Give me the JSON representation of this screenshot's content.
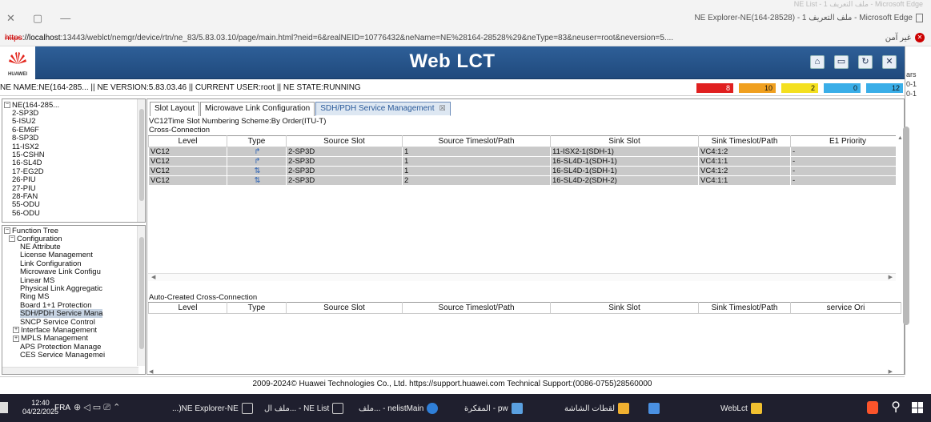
{
  "browser": {
    "window_title": "NE Explorer-NE(164-28528) - 1 ملف التعريف - Microsoft Edge",
    "faded_title": "NE List - 1 ملف التعريف - Microsoft Edge",
    "url_protocol": "https",
    "url_host": "://localhost",
    "url_rest": ":13443/weblct/nemgr/device/rtn/ne_83/5.83.03.10/page/main.html?neid=6&realNEID=10776432&neName=NE%28164-28528%29&neType=83&neuser=root&neversion=5....",
    "not_secure": "غير آمن",
    "minimize": "—",
    "restore": "▢",
    "close": "✕"
  },
  "app": {
    "title": "Web LCT",
    "logo_text": "HUAWEI",
    "header_icons": [
      "home-icon",
      "monitor-icon",
      "refresh-icon",
      "close-icon"
    ],
    "ne_info": "NE NAME:NE(164-285... || NE VERSION:5.83.03.46 || CURRENT USER:root || NE STATE:RUNNING",
    "alarms": [
      {
        "value": "8",
        "color": "#e02020"
      },
      {
        "value": "10",
        "color": "#f0a020"
      },
      {
        "value": "2",
        "color": "#f4e020"
      },
      {
        "value": "0",
        "color": "#3aaee8"
      },
      {
        "value": "12",
        "color": "#3aaee8"
      }
    ]
  },
  "clipped_window": {
    "line1": "ars",
    "line2": "0-1",
    "line3": "0-1"
  },
  "ne_tree": {
    "root": "NE(164-285...",
    "items": [
      "2-SP3D",
      "5-ISU2",
      "6-EM6F",
      "8-SP3D",
      "11-ISX2",
      "15-CSHN",
      "16-SL4D",
      "17-EG2D",
      "26-PIU",
      "27-PIU",
      "28-FAN",
      "55-ODU",
      "56-ODU"
    ]
  },
  "function_tree": {
    "root": "Function Tree",
    "configuration": "Configuration",
    "items": [
      {
        "label": "NE Attribute",
        "expander": false,
        "selected": false
      },
      {
        "label": "License Management",
        "expander": false,
        "selected": false
      },
      {
        "label": "Link Configuration",
        "expander": false,
        "selected": false
      },
      {
        "label": "Microwave Link Configu",
        "expander": false,
        "selected": false
      },
      {
        "label": "Linear MS",
        "expander": false,
        "selected": false
      },
      {
        "label": "Physical Link Aggregatic",
        "expander": false,
        "selected": false
      },
      {
        "label": "Ring MS",
        "expander": false,
        "selected": false
      },
      {
        "label": "Board 1+1 Protection",
        "expander": false,
        "selected": false
      },
      {
        "label": "SDH/PDH Service Mana",
        "expander": false,
        "selected": true
      },
      {
        "label": "SNCP Service Control",
        "expander": false,
        "selected": false
      },
      {
        "label": "Interface Management",
        "expander": true,
        "selected": false
      },
      {
        "label": "MPLS Management",
        "expander": true,
        "selected": false
      },
      {
        "label": "APS Protection Manage",
        "expander": false,
        "selected": false
      },
      {
        "label": "CES Service Managemei",
        "expander": false,
        "selected": false
      }
    ]
  },
  "tabs": [
    {
      "label": "Slot Layout",
      "active": false
    },
    {
      "label": "Microwave Link Configuration",
      "active": false
    },
    {
      "label": "SDH/PDH Service Management",
      "active": true,
      "close": "☒"
    }
  ],
  "scheme_text": "VC12Time Slot Numbering Scheme:By Order(ITU-T)",
  "cross_connection": {
    "label": "Cross-Connection",
    "columns": [
      "Level",
      "Type",
      "Source Slot",
      "Source Timeslot/Path",
      "Sink Slot",
      "Sink Timeslot/Path",
      "E1 Priority"
    ],
    "rows": [
      [
        "VC12",
        "↱",
        "2-SP3D",
        "1",
        "11-ISX2-1(SDH-1)",
        "VC4:1:2",
        "-"
      ],
      [
        "VC12",
        "↱",
        "2-SP3D",
        "1",
        "16-SL4D-1(SDH-1)",
        "VC4:1:1",
        "-"
      ],
      [
        "VC12",
        "⇅",
        "2-SP3D",
        "1",
        "16-SL4D-1(SDH-1)",
        "VC4:1:2",
        "-"
      ],
      [
        "VC12",
        "⇅",
        "2-SP3D",
        "2",
        "16-SL4D-2(SDH-2)",
        "VC4:1:1",
        "-"
      ]
    ]
  },
  "auto_created": {
    "label": "Auto-Created Cross-Connection",
    "columns": [
      "Level",
      "Type",
      "Source Slot",
      "Source Timeslot/Path",
      "Sink Slot",
      "Sink Timeslot/Path",
      "service Ori"
    ]
  },
  "footer": "2009-2024© Huawei Technologies Co., Ltd. https://support.huawei.com Technical Support:(0086-0755)28560000",
  "taskbar": {
    "time": "12:40",
    "date": "04/22/2025",
    "lang": "FRA",
    "tray": "⊕ ◁ ▭ ⎚ ⌃",
    "tasks": [
      {
        "label": "...)NE Explorer-NE",
        "color": "#eee"
      },
      {
        "label": "ملف ال... - NE List",
        "color": "#eee"
      },
      {
        "label": "ملف... - nelistMain",
        "color": "#2f7fd8"
      },
      {
        "label": "المفكرة - pw",
        "color": "#5aa0e0"
      },
      {
        "label": "لقطات الشاشة",
        "color": "#f0b030"
      },
      {
        "label": "",
        "color": "#4a90e2"
      },
      {
        "label": "WebLct",
        "color": "#f0c030"
      }
    ]
  }
}
